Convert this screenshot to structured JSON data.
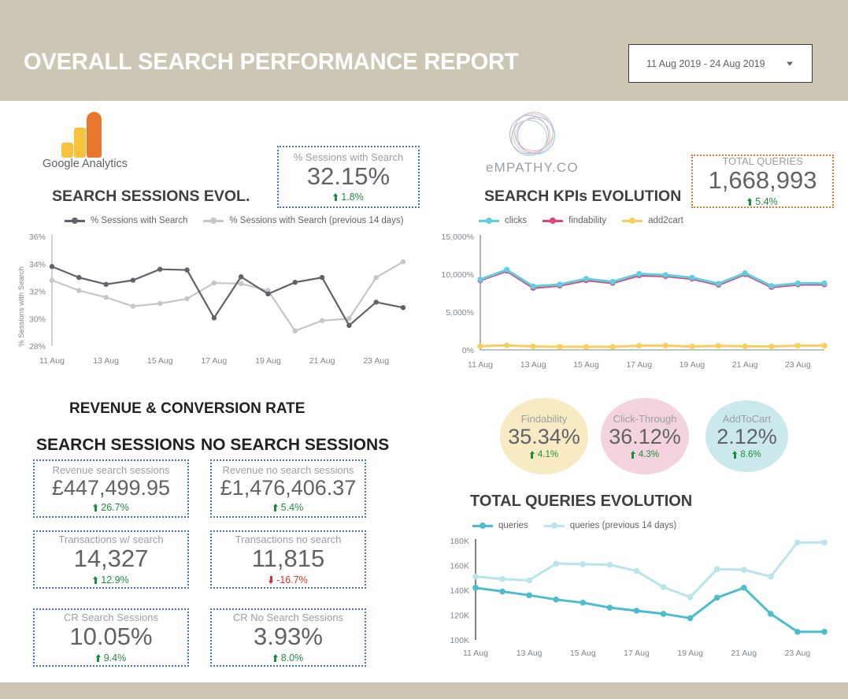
{
  "header": {
    "title": "OVERALL SEARCH PERFORMANCE REPORT",
    "date_range": "11 Aug 2019 - 24 Aug 2019",
    "background_color": "#cdc6b4"
  },
  "left_panel": {
    "logo_wordmark_brand": "Google",
    "logo_wordmark_product": " Analytics",
    "chart_title": "SEARCH SESSIONS EVOL.",
    "scorecard": {
      "label": "% Sessions with Search",
      "value": "32.15%",
      "delta": "1.8%",
      "delta_direction": "up",
      "border_color": "#3f6fd1"
    }
  },
  "right_panel": {
    "logo_wordmark": "еMPATHY.CO",
    "chart_title": "SEARCH KPIs EVOLUTION",
    "scorecard": {
      "label": "TOTAL QUERIES",
      "value": "1,668,993",
      "delta": "5.4%",
      "delta_direction": "up",
      "border_color": "#e8762c"
    }
  },
  "kpi_circles": [
    {
      "label": "Findability",
      "value": "35.34%",
      "delta": "4.1%",
      "color": "#f8ebc4"
    },
    {
      "label": "Click-Through",
      "value": "36.12%",
      "delta": "4.3%",
      "color": "#f3d3de"
    },
    {
      "label": "AddToCart",
      "value": "2.12%",
      "delta": "8.6%",
      "color": "#cbe8ec"
    }
  ],
  "revenue_section": {
    "title": "REVENUE & CONVERSION RATE",
    "column_headers": [
      "SEARCH SESSIONS",
      "NO SEARCH SESSIONS"
    ],
    "cards": [
      {
        "label": "Revenue search sessions",
        "value": "£447,499.95",
        "delta": "26.7%",
        "delta_direction": "up"
      },
      {
        "label": "Revenue no search sessions",
        "value": "£1,476,406.37",
        "delta": "5.4%",
        "delta_direction": "up"
      },
      {
        "label": "Transactions w/ search",
        "value": "14,327",
        "delta": "12.9%",
        "delta_direction": "up"
      },
      {
        "label": "Transactions no search",
        "value": "11,815",
        "delta": "-16.7%",
        "delta_direction": "down"
      },
      {
        "label": "CR Search Sessions",
        "value": "10.05%",
        "delta": "9.4%",
        "delta_direction": "up"
      },
      {
        "label": "CR No Search Sessions",
        "value": "3.93%",
        "delta": "8.0%",
        "delta_direction": "up"
      }
    ]
  },
  "queries_section": {
    "title": "TOTAL QUERIES EVOLUTION"
  },
  "chart_data": [
    {
      "id": "search_sessions_evolution",
      "type": "line",
      "title": "SEARCH SESSIONS EVOL.",
      "xlabel": "",
      "ylabel": "% Sessions with Search",
      "ylim": [
        28,
        36
      ],
      "yticks": [
        "28%",
        "30%",
        "32%",
        "34%",
        "36%"
      ],
      "ytick_values": [
        28,
        30,
        32,
        34,
        36
      ],
      "x": [
        "11 Aug",
        "12 Aug",
        "13 Aug",
        "14 Aug",
        "15 Aug",
        "16 Aug",
        "17 Aug",
        "18 Aug",
        "19 Aug",
        "20 Aug",
        "21 Aug",
        "22 Aug",
        "23 Aug",
        "24 Aug"
      ],
      "xticks": [
        "11 Aug",
        "13 Aug",
        "15 Aug",
        "17 Aug",
        "19 Aug",
        "21 Aug",
        "23 Aug"
      ],
      "grid": false,
      "legend_position": "top",
      "series": [
        {
          "name": "% Sessions with Search",
          "color": "#5f6368",
          "values": [
            33.8,
            33.0,
            32.5,
            32.8,
            33.6,
            33.55,
            30.05,
            33.05,
            31.8,
            32.65,
            33.0,
            29.5,
            31.2,
            30.8
          ]
        },
        {
          "name": "% Sessions with Search (previous 14 days)",
          "color": "#c4c7c5",
          "values": [
            32.8,
            32.05,
            31.55,
            30.9,
            31.1,
            31.45,
            32.6,
            32.55,
            32.05,
            29.1,
            29.85,
            30.0,
            33.0,
            34.15
          ]
        }
      ]
    },
    {
      "id": "search_kpis_evolution",
      "type": "line",
      "title": "SEARCH KPIs EVOLUTION",
      "xlabel": "",
      "ylabel": "",
      "ylim": [
        0,
        15000
      ],
      "yticks": [
        "0%",
        "5,000%",
        "10,000%",
        "15,000%"
      ],
      "ytick_values": [
        0,
        5000,
        10000,
        15000
      ],
      "x": [
        "11 Aug",
        "12 Aug",
        "13 Aug",
        "14 Aug",
        "15 Aug",
        "16 Aug",
        "17 Aug",
        "18 Aug",
        "19 Aug",
        "20 Aug",
        "21 Aug",
        "22 Aug",
        "23 Aug",
        "24 Aug"
      ],
      "xticks": [
        "11 Aug",
        "13 Aug",
        "15 Aug",
        "17 Aug",
        "19 Aug",
        "21 Aug",
        "23 Aug"
      ],
      "grid": false,
      "legend_position": "top",
      "series": [
        {
          "name": "clicks",
          "color": "#5ecfe0",
          "values": [
            9300,
            10600,
            8400,
            8650,
            9400,
            9000,
            10050,
            9900,
            9550,
            8750,
            10150,
            8450,
            8800,
            8800
          ]
        },
        {
          "name": "findability",
          "color": "#e0447c",
          "values": [
            9200,
            10450,
            8200,
            8500,
            9200,
            8850,
            9850,
            9750,
            9400,
            8600,
            10000,
            8300,
            8650,
            8650
          ]
        },
        {
          "name": "add2cart",
          "color": "#f8cf5c",
          "values": [
            500,
            600,
            460,
            420,
            400,
            400,
            560,
            560,
            460,
            540,
            480,
            460,
            560,
            560
          ]
        }
      ]
    },
    {
      "id": "total_queries_evolution",
      "type": "line",
      "title": "TOTAL QUERIES EVOLUTION",
      "xlabel": "",
      "ylabel": "",
      "ylim": [
        100000,
        180000
      ],
      "yticks": [
        "100K",
        "120K",
        "140K",
        "160K",
        "180K"
      ],
      "ytick_values": [
        100000,
        120000,
        140000,
        160000,
        180000
      ],
      "x": [
        "11 Aug",
        "12 Aug",
        "13 Aug",
        "14 Aug",
        "15 Aug",
        "16 Aug",
        "17 Aug",
        "18 Aug",
        "19 Aug",
        "20 Aug",
        "21 Aug",
        "22 Aug",
        "23 Aug",
        "24 Aug"
      ],
      "xticks": [
        "11 Aug",
        "13 Aug",
        "15 Aug",
        "17 Aug",
        "19 Aug",
        "21 Aug",
        "23 Aug"
      ],
      "grid": false,
      "legend_position": "top",
      "series": [
        {
          "name": "queries",
          "color": "#4bbdd1",
          "values": [
            142000,
            139000,
            136000,
            132500,
            130000,
            126000,
            123500,
            121000,
            117500,
            134000,
            142000,
            121000,
            106500,
            106500
          ]
        },
        {
          "name": "queries (previous 14 days)",
          "color": "#b8e5ec",
          "values": [
            151000,
            149000,
            148000,
            161500,
            161000,
            160500,
            155500,
            142500,
            134500,
            157000,
            156500,
            151000,
            178500,
            178500
          ]
        }
      ]
    }
  ]
}
